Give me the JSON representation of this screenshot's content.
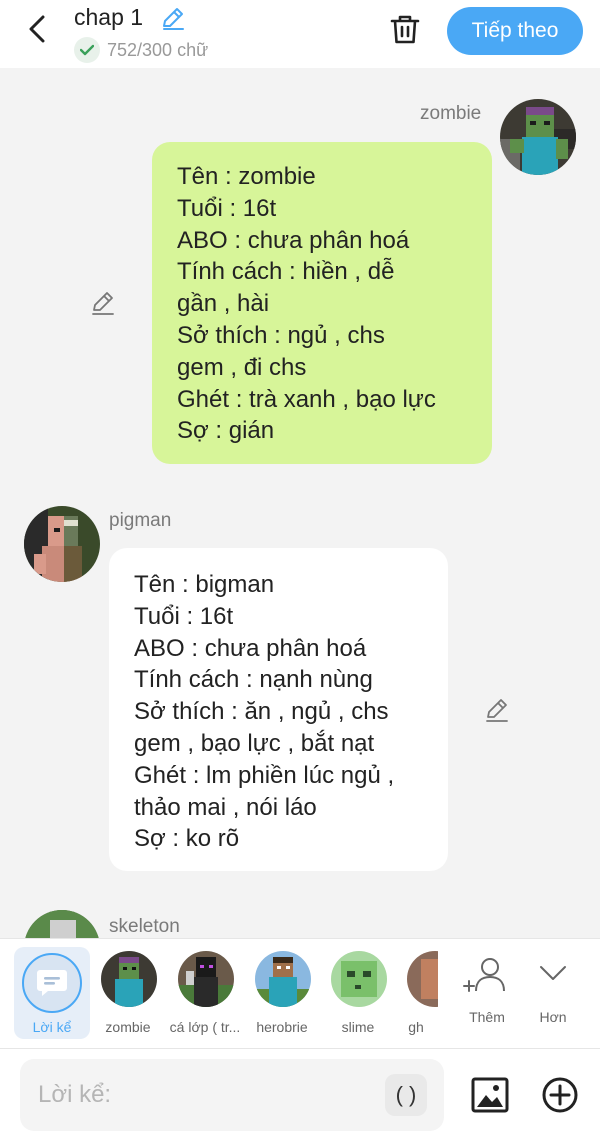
{
  "header": {
    "title": "chap 1",
    "word_count": "752/300 chữ",
    "next_label": "Tiếp theo"
  },
  "messages": [
    {
      "name": "zombie",
      "lines": [
        "Tên : zombie",
        "Tuổi : 16t",
        "ABO : chưa phân hoá",
        "Tính cách : hiền , dễ",
        "gần , hài",
        "Sở thích : ngủ , chs",
        "gem , đi chs",
        "Ghét : trà xanh , bạo lực",
        "Sợ : gián"
      ]
    },
    {
      "name": "pigman",
      "lines": [
        "Tên : bigman",
        "Tuổi : 16t",
        "ABO : chưa phân hoá",
        "Tính cách : nạnh nùng",
        "Sở thích : ăn , ngủ , chs",
        "gem , bạo lực , bắt nạt",
        "Ghét : lm phiền lúc ngủ ,",
        "thảo mai , nói láo",
        "Sợ : ko rõ"
      ]
    },
    {
      "name": "skeleton"
    }
  ],
  "strip": {
    "narrator_label": "Lời kể",
    "characters": [
      "zombie",
      "cá lớp ( tr...",
      "herobrie",
      "slime",
      "gh"
    ],
    "more_label": "Thêm",
    "expand_label": "Hơn"
  },
  "input": {
    "placeholder": "Lời kể:",
    "paren_label": "( )"
  },
  "colors": {
    "accent": "#4aa8f5",
    "bubble_green": "#d7f599",
    "bubble_white": "#ffffff",
    "background": "#f3f3f3"
  }
}
